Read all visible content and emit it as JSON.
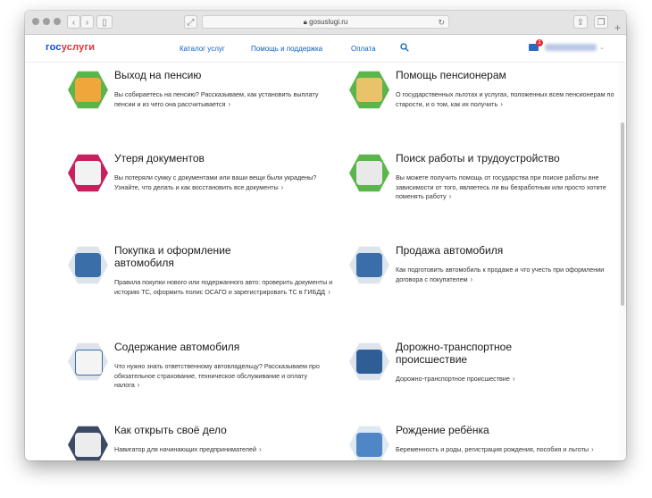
{
  "browser": {
    "url": "gosuslugi.ru"
  },
  "header": {
    "logo": {
      "part1": "гос",
      "part2": "услуги"
    },
    "nav": [
      "Каталог услуг",
      "Помощь и поддержка",
      "Оплата"
    ],
    "mail_badge": "2"
  },
  "cards": [
    {
      "title": "Выход на пенсию",
      "desc": "Вы собираетесь на пенсию? Рассказываем, как установить выплату пенсии и из чего она рассчитывается",
      "more": "›"
    },
    {
      "title": "Помощь пенсионерам",
      "desc": "О государственных льготах и услугах, положенных всем пенсионерам по старости, и о том, как их получить",
      "more": "›"
    },
    {
      "title": "Утеря документов",
      "desc": "Вы потеряли сумку с документами или ваши вещи были украдены? Узнайте, что делать и как восстановить все документы",
      "more": "›"
    },
    {
      "title": "Поиск работы и трудоустройство",
      "desc": "Вы можете получить помощь от государства при поиске работы вне зависимости от того, являетесь ли вы безработным или просто хотите поменять работу",
      "more": "›"
    },
    {
      "title": "Покупка и оформление автомобиля",
      "desc": "Правила покупки нового или подержанного авто: проверить документы и историю ТС, оформить полис ОСАГО и зарегистрировать ТС в ГИБДД",
      "more": "›"
    },
    {
      "title": "Продажа автомобиля",
      "desc": "Как подготовить автомобиль к продаже и что учесть при оформлении договора с покупателем",
      "more": "›"
    },
    {
      "title": "Содержание автомобиля",
      "desc": "Что нужно знать ответственному автовладельцу? Рассказываем про обязательное страхование, техническое обслуживание и оплату налога",
      "more": "›"
    },
    {
      "title": "Дорожно-транспортное происшествие",
      "desc": "Дорожно-транспортное происшествие",
      "more": "›"
    },
    {
      "title": "Как открыть своё дело",
      "desc": "Навигатор для начинающих предпринимателей",
      "more": "›"
    },
    {
      "title": "Рождение ребёнка",
      "desc": "Беременность и роды, регистрация рождения, пособия и льготы",
      "more": "›"
    }
  ],
  "icons": [
    {
      "name": "pension-icon",
      "bg": "#5bb54a",
      "art": "#f0a63a"
    },
    {
      "name": "pensioners-help-icon",
      "bg": "#5bb54a",
      "art": "#e8c36a"
    },
    {
      "name": "lost-documents-icon",
      "bg": "#c8205e",
      "art": "#f2f2f2"
    },
    {
      "name": "job-search-icon",
      "bg": "#5bb54a",
      "art": "#e9e9e9"
    },
    {
      "name": "car-purchase-icon",
      "bg": "#dde4ec",
      "art": "#3a6ea8"
    },
    {
      "name": "car-sale-icon",
      "bg": "#dde4ec",
      "art": "#3a6ea8"
    },
    {
      "name": "car-maintenance-icon",
      "bg": "#dde4ec",
      "art": "#f4f4f4"
    },
    {
      "name": "road-accident-icon",
      "bg": "#dde4ec",
      "art": "#2f5d96"
    },
    {
      "name": "own-business-icon",
      "bg": "#3d4a63",
      "art": "#ececec"
    },
    {
      "name": "child-birth-icon",
      "bg": "#dde8f0",
      "art": "#4e86c6"
    }
  ]
}
